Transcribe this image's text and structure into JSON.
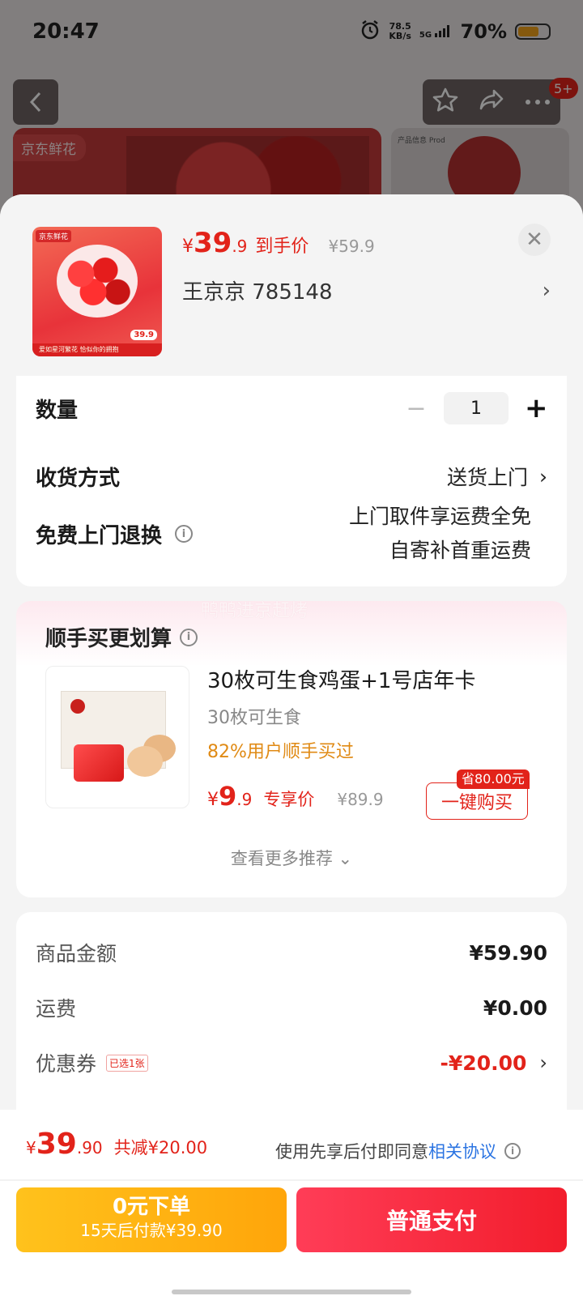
{
  "status": {
    "time": "20:47",
    "speed_value": "78.5",
    "speed_unit": "KB/s",
    "network": "5G",
    "battery": "70%",
    "battery_level": 0.7
  },
  "background": {
    "hero_tag": "京东鲜花",
    "side_label": "产品信息 Prod",
    "badge_count": "5+"
  },
  "product": {
    "image_tag": "京东鲜花",
    "image_footer": "爱如星河繁花 恰似你的拥抱",
    "image_price": "39.9",
    "price_currency": "¥",
    "price_int": "39",
    "price_dec": ".9",
    "price_label": "到手价",
    "original_price": "¥59.9",
    "address": "王京京  785148"
  },
  "options": {
    "quantity_label": "数量",
    "quantity_value": "1",
    "shipping_label": "收货方式",
    "shipping_value": "送货上门",
    "return_label": "免费上门退换",
    "return_line1": "上门取件享运费全免",
    "return_line2": "自寄补首重运费"
  },
  "recommend": {
    "title": "顺手买更划算",
    "watermark": "鸭鸭进京赶烤",
    "product_name": "30枚可生食鸡蛋+1号店年卡",
    "product_sub": "30枚可生食",
    "bought_text": "82%用户顺手买过",
    "price_currency": "¥",
    "price_int": "9",
    "price_dec": ".9",
    "price_label": "专享价",
    "original_price": "¥89.9",
    "save_badge": "省80.00元",
    "buy_button": "一键购买",
    "more_link": "查看更多推荐"
  },
  "amounts": {
    "goods_label": "商品金额",
    "goods_value": "¥59.90",
    "freight_label": "运费",
    "freight_value": "¥0.00",
    "coupon_label": "优惠券",
    "coupon_tag": "已选1张",
    "coupon_value": "-¥20.00"
  },
  "footer": {
    "total_currency": "¥",
    "total_int": "39",
    "total_dec": ".90",
    "reduce_text": "共减¥20.00",
    "agree_prefix": "使用先享后付即同意",
    "agree_link": "相关协议",
    "later_main": "0元下单",
    "later_sub": "15天后付款¥39.90",
    "pay_button": "普通支付"
  },
  "colors": {
    "accent_red": "#e2231a",
    "link_blue": "#2b74e2",
    "later_gold": "#ffb416",
    "bought_orange": "#e08a14"
  }
}
